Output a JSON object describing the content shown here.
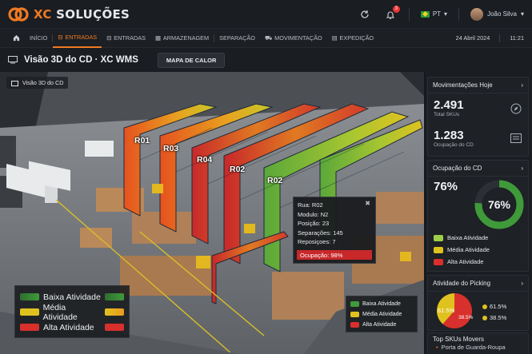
{
  "brand": {
    "prefix": "XC",
    "name": "SOLUÇÕES"
  },
  "header": {
    "language": "PT",
    "user_name": "João Silva",
    "notification_count": "3"
  },
  "nav": {
    "home": "INÍCIO",
    "items": [
      "ENTRADAS",
      "ENTRADAS",
      "ARMAZENAGEM",
      "SEPARAÇÃO",
      "MOVIMENTAÇÃO",
      "EXPEDIÇÃO"
    ],
    "date": "24 Abril 2024",
    "time": "11:21"
  },
  "page": {
    "title": "Visão 3D do CD · XC WMS",
    "heatmap_button": "MAPA DE CALOR",
    "scene_label": "Visão 3D do CD"
  },
  "racks": [
    "R01",
    "R03",
    "R04",
    "R02",
    "R02"
  ],
  "tooltip": {
    "lines": [
      "Rua: R02",
      "Modulo: N2",
      "Posição: 23",
      "Separações: 145",
      "Reposiçoes: 7"
    ],
    "occupation": "Ocupação: 98%"
  },
  "legend": {
    "items": [
      {
        "label": "Baixa Atividade",
        "color": "#3f9a3a"
      },
      {
        "label": "Média Atividade",
        "color": "#e0c21f"
      },
      {
        "label": "Alta Atividade",
        "color": "#d8302c"
      }
    ]
  },
  "panels": {
    "movements": {
      "title": "Movimentações Hoje",
      "total_value": "2.491",
      "total_label": "Total SKUs",
      "occ_value": "1.283",
      "occ_label": "Ocupação do CD"
    },
    "occupation": {
      "title": "Ocupação do CD",
      "value": "76%",
      "ring_value": "76%",
      "percent": 76
    },
    "picking": {
      "title": "Atividade do Picking",
      "slices": [
        61.5,
        38.5
      ],
      "label_a": "61.5%",
      "label_b": "38.5%"
    },
    "top_skus": {
      "title": "Top SKUs Movers",
      "first_item": "Porta de Guarda-Roupa"
    }
  },
  "colors": {
    "accent": "#f07a22",
    "low": "#3f9a3a",
    "mid": "#e0c21f",
    "high": "#d8302c"
  }
}
